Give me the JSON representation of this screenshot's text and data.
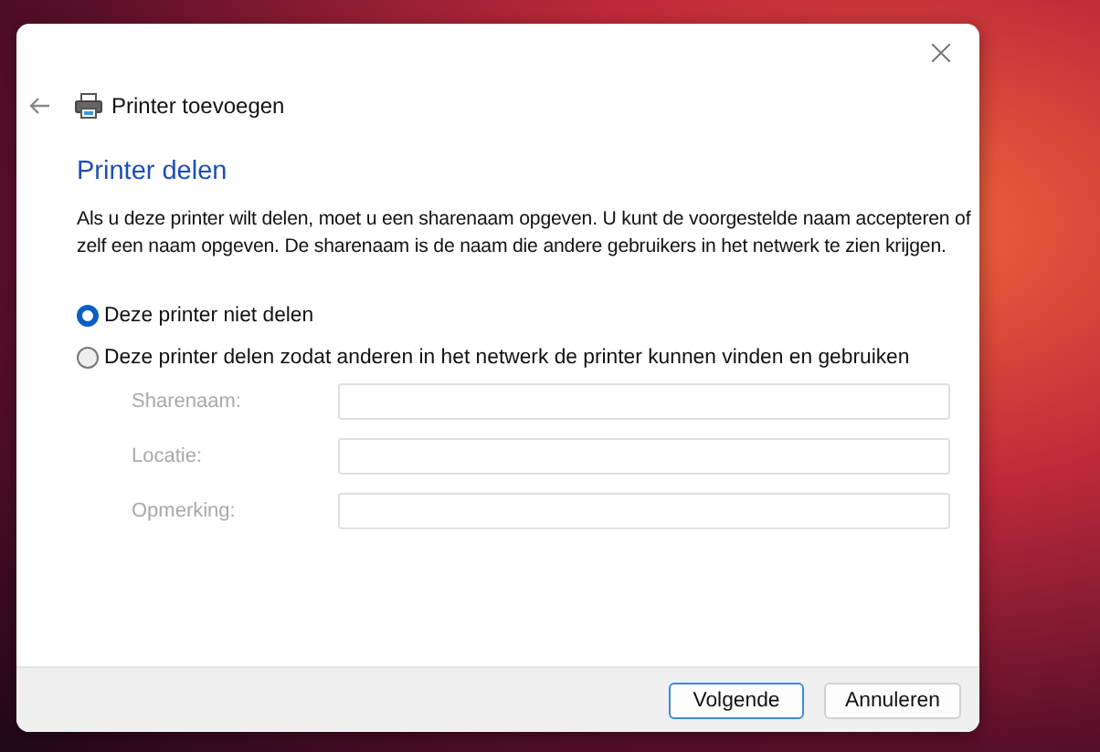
{
  "window": {
    "title": "Printer toevoegen"
  },
  "heading": "Printer delen",
  "description": "Als u deze printer wilt delen, moet u een sharenaam opgeven. U kunt de voorgestelde naam accepteren of zelf een naam opgeven. De sharenaam is de naam die andere gebruikers in het netwerk te zien krijgen.",
  "options": [
    {
      "label": "Deze printer niet delen",
      "selected": true
    },
    {
      "label": "Deze printer delen zodat anderen in het netwerk de printer kunnen vinden en gebruiken",
      "selected": false
    }
  ],
  "fields": [
    {
      "label": "Sharenaam:",
      "disabled": true
    },
    {
      "label": "Locatie:",
      "disabled": true
    },
    {
      "label": "Opmerking:",
      "disabled": true
    }
  ],
  "buttons": [
    {
      "label": "Volgende",
      "kind": "primary"
    },
    {
      "label": "Annuleren",
      "kind": "secondary"
    }
  ]
}
